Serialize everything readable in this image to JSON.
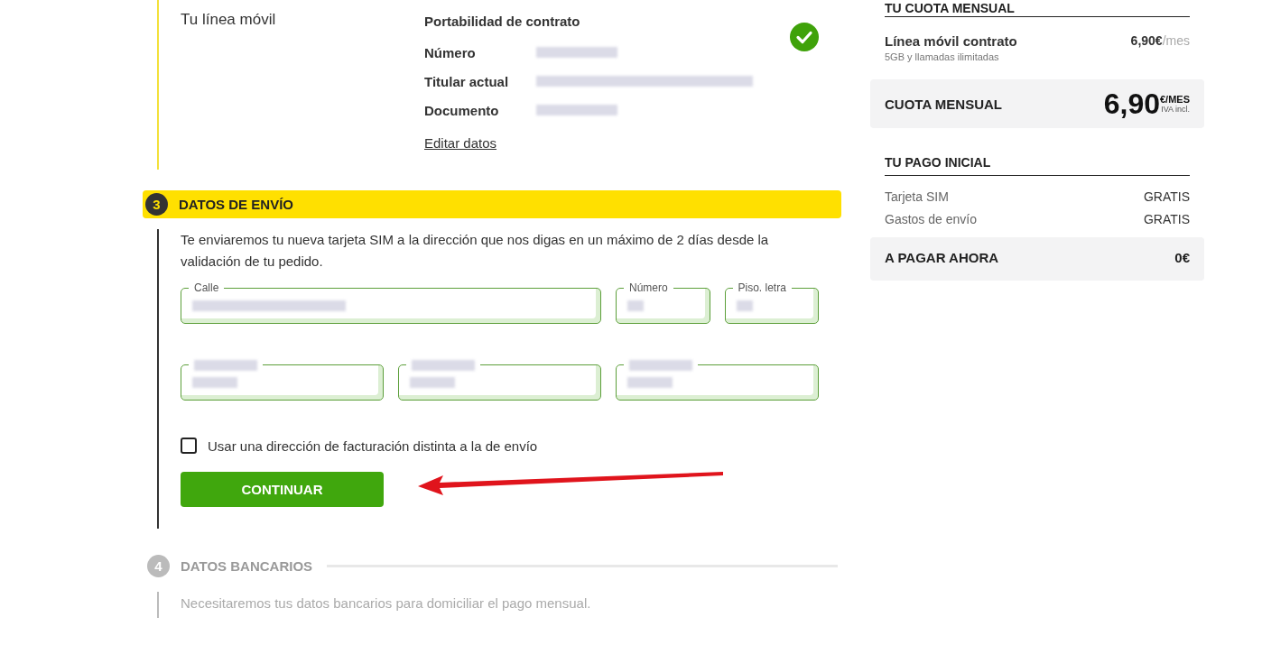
{
  "steps": [
    {
      "kind": "done",
      "label": "Tu línea móvil",
      "title": "Portabilidad de contrato",
      "completed": true,
      "details": [
        {
          "label": "Número",
          "redacted": true
        },
        {
          "label": "Titular actual",
          "redacted": true
        },
        {
          "label": "Documento",
          "redacted": true
        }
      ],
      "link": "Editar datos"
    },
    {
      "kind": "active",
      "number": "3",
      "title": "DATOS DE ENVÍO",
      "intro": "Te enviaremos tu nueva tarjeta SIM a la dirección que nos digas en un máximo de 2 días desde la validación de tu pedido.",
      "fields": [
        {
          "label": "Calle",
          "value_redacted": true
        },
        {
          "label": "Número",
          "value_redacted": true
        },
        {
          "label": "Piso. letra",
          "value_redacted": true
        },
        {
          "label_redacted": true,
          "value_redacted": true
        },
        {
          "label_redacted": true,
          "value_redacted": true
        },
        {
          "label_redacted": true,
          "value_redacted": true
        }
      ],
      "checkbox": {
        "label": "Usar una dirección de facturación distinta a la de envío",
        "checked": false
      },
      "button": "CONTINUAR"
    },
    {
      "kind": "pending",
      "number": "4",
      "title": "DATOS BANCARIOS",
      "intro": "Necesitaremos tus datos bancarios para domiciliar el pago mensual."
    }
  ],
  "summary": {
    "monthly_heading": "TU CUOTA MENSUAL",
    "line": {
      "name": "Línea móvil contrato",
      "detail": "5GB y llamadas ilimitadas",
      "price": "6,90€",
      "unit": "/mes"
    },
    "monthly_total": {
      "label": "CUOTA MENSUAL",
      "amount": "6,90",
      "unit": "€/MES",
      "tax": "IVA incl."
    },
    "initial_heading": "TU PAGO INICIAL",
    "initial_items": [
      {
        "label": "Tarjeta SIM",
        "value": "GRATIS"
      },
      {
        "label": "Gastos de envío",
        "value": "GRATIS"
      }
    ],
    "pay_now": {
      "label": "A PAGAR AHORA",
      "amount": "0€"
    }
  }
}
